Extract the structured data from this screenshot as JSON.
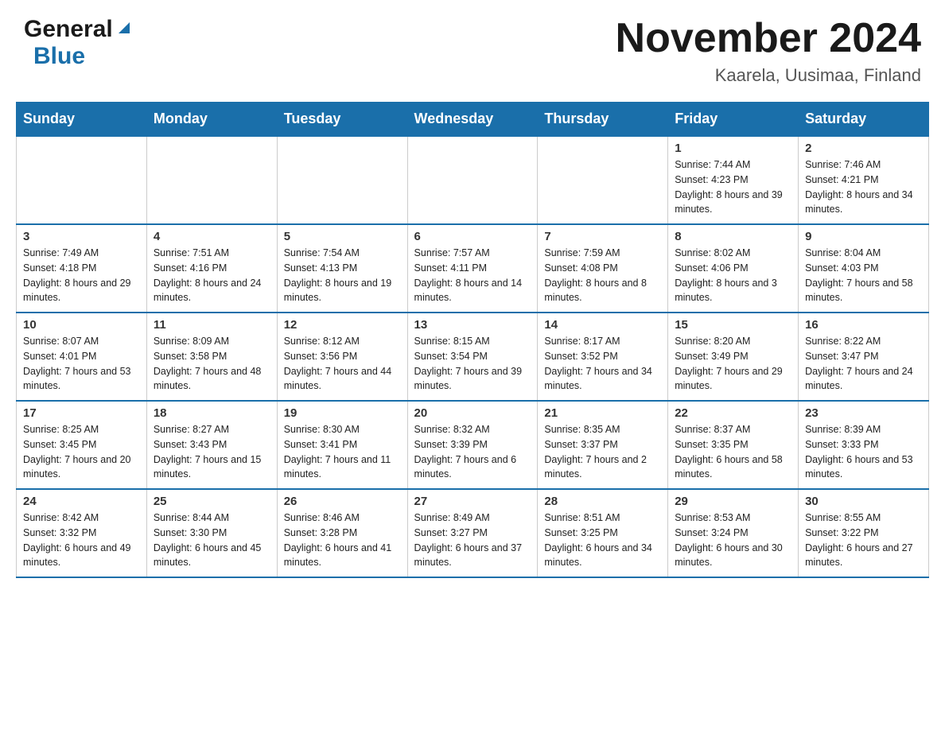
{
  "header": {
    "logo_general": "General",
    "logo_blue": "Blue",
    "month_title": "November 2024",
    "location": "Kaarela, Uusimaa, Finland"
  },
  "days_of_week": [
    "Sunday",
    "Monday",
    "Tuesday",
    "Wednesday",
    "Thursday",
    "Friday",
    "Saturday"
  ],
  "weeks": [
    {
      "days": [
        {
          "number": "",
          "info": ""
        },
        {
          "number": "",
          "info": ""
        },
        {
          "number": "",
          "info": ""
        },
        {
          "number": "",
          "info": ""
        },
        {
          "number": "",
          "info": ""
        },
        {
          "number": "1",
          "info": "Sunrise: 7:44 AM\nSunset: 4:23 PM\nDaylight: 8 hours and 39 minutes."
        },
        {
          "number": "2",
          "info": "Sunrise: 7:46 AM\nSunset: 4:21 PM\nDaylight: 8 hours and 34 minutes."
        }
      ]
    },
    {
      "days": [
        {
          "number": "3",
          "info": "Sunrise: 7:49 AM\nSunset: 4:18 PM\nDaylight: 8 hours and 29 minutes."
        },
        {
          "number": "4",
          "info": "Sunrise: 7:51 AM\nSunset: 4:16 PM\nDaylight: 8 hours and 24 minutes."
        },
        {
          "number": "5",
          "info": "Sunrise: 7:54 AM\nSunset: 4:13 PM\nDaylight: 8 hours and 19 minutes."
        },
        {
          "number": "6",
          "info": "Sunrise: 7:57 AM\nSunset: 4:11 PM\nDaylight: 8 hours and 14 minutes."
        },
        {
          "number": "7",
          "info": "Sunrise: 7:59 AM\nSunset: 4:08 PM\nDaylight: 8 hours and 8 minutes."
        },
        {
          "number": "8",
          "info": "Sunrise: 8:02 AM\nSunset: 4:06 PM\nDaylight: 8 hours and 3 minutes."
        },
        {
          "number": "9",
          "info": "Sunrise: 8:04 AM\nSunset: 4:03 PM\nDaylight: 7 hours and 58 minutes."
        }
      ]
    },
    {
      "days": [
        {
          "number": "10",
          "info": "Sunrise: 8:07 AM\nSunset: 4:01 PM\nDaylight: 7 hours and 53 minutes."
        },
        {
          "number": "11",
          "info": "Sunrise: 8:09 AM\nSunset: 3:58 PM\nDaylight: 7 hours and 48 minutes."
        },
        {
          "number": "12",
          "info": "Sunrise: 8:12 AM\nSunset: 3:56 PM\nDaylight: 7 hours and 44 minutes."
        },
        {
          "number": "13",
          "info": "Sunrise: 8:15 AM\nSunset: 3:54 PM\nDaylight: 7 hours and 39 minutes."
        },
        {
          "number": "14",
          "info": "Sunrise: 8:17 AM\nSunset: 3:52 PM\nDaylight: 7 hours and 34 minutes."
        },
        {
          "number": "15",
          "info": "Sunrise: 8:20 AM\nSunset: 3:49 PM\nDaylight: 7 hours and 29 minutes."
        },
        {
          "number": "16",
          "info": "Sunrise: 8:22 AM\nSunset: 3:47 PM\nDaylight: 7 hours and 24 minutes."
        }
      ]
    },
    {
      "days": [
        {
          "number": "17",
          "info": "Sunrise: 8:25 AM\nSunset: 3:45 PM\nDaylight: 7 hours and 20 minutes."
        },
        {
          "number": "18",
          "info": "Sunrise: 8:27 AM\nSunset: 3:43 PM\nDaylight: 7 hours and 15 minutes."
        },
        {
          "number": "19",
          "info": "Sunrise: 8:30 AM\nSunset: 3:41 PM\nDaylight: 7 hours and 11 minutes."
        },
        {
          "number": "20",
          "info": "Sunrise: 8:32 AM\nSunset: 3:39 PM\nDaylight: 7 hours and 6 minutes."
        },
        {
          "number": "21",
          "info": "Sunrise: 8:35 AM\nSunset: 3:37 PM\nDaylight: 7 hours and 2 minutes."
        },
        {
          "number": "22",
          "info": "Sunrise: 8:37 AM\nSunset: 3:35 PM\nDaylight: 6 hours and 58 minutes."
        },
        {
          "number": "23",
          "info": "Sunrise: 8:39 AM\nSunset: 3:33 PM\nDaylight: 6 hours and 53 minutes."
        }
      ]
    },
    {
      "days": [
        {
          "number": "24",
          "info": "Sunrise: 8:42 AM\nSunset: 3:32 PM\nDaylight: 6 hours and 49 minutes."
        },
        {
          "number": "25",
          "info": "Sunrise: 8:44 AM\nSunset: 3:30 PM\nDaylight: 6 hours and 45 minutes."
        },
        {
          "number": "26",
          "info": "Sunrise: 8:46 AM\nSunset: 3:28 PM\nDaylight: 6 hours and 41 minutes."
        },
        {
          "number": "27",
          "info": "Sunrise: 8:49 AM\nSunset: 3:27 PM\nDaylight: 6 hours and 37 minutes."
        },
        {
          "number": "28",
          "info": "Sunrise: 8:51 AM\nSunset: 3:25 PM\nDaylight: 6 hours and 34 minutes."
        },
        {
          "number": "29",
          "info": "Sunrise: 8:53 AM\nSunset: 3:24 PM\nDaylight: 6 hours and 30 minutes."
        },
        {
          "number": "30",
          "info": "Sunrise: 8:55 AM\nSunset: 3:22 PM\nDaylight: 6 hours and 27 minutes."
        }
      ]
    }
  ]
}
